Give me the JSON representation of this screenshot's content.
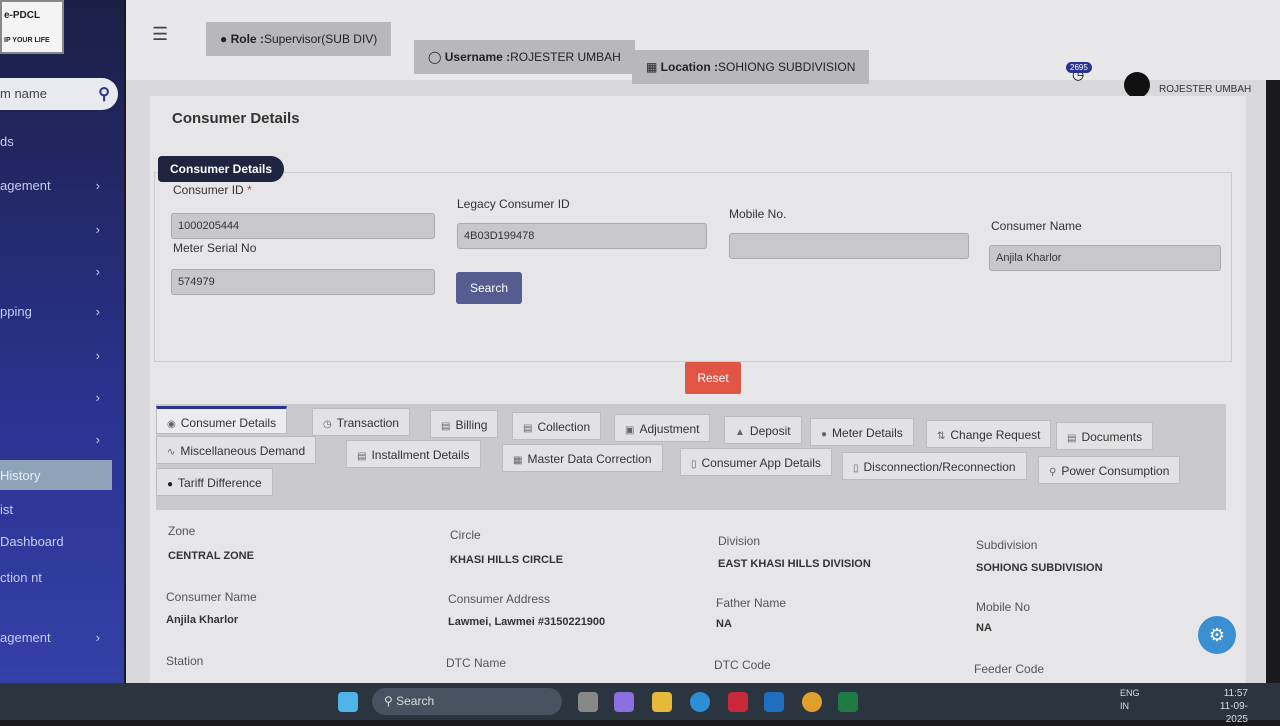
{
  "sidebar": {
    "logo_text": "e-PDCL",
    "logo_tagline": "IP YOUR LIFE",
    "search_placeholder": "m name",
    "items": [
      {
        "label": "ds"
      },
      {
        "label": "agement"
      },
      {
        "label": ""
      },
      {
        "label": ""
      },
      {
        "label": "pping"
      },
      {
        "label": ""
      },
      {
        "label": ""
      },
      {
        "label": "History"
      },
      {
        "label": "ist"
      },
      {
        "label": "Dashboard"
      },
      {
        "label": "ction nt"
      },
      {
        "label": "agement"
      }
    ]
  },
  "header": {
    "role_label": "Role :",
    "role_value": "Supervisor(SUB DIV)",
    "username_label": "Username :",
    "username_value": "ROJESTER UMBAH",
    "location_label": "Location :",
    "location_value": "SOHIONG SUBDIVISION",
    "notification_count": "2695",
    "user_name": "ROJESTER UMBAH"
  },
  "page": {
    "title": "Consumer Details",
    "form_badge": "Consumer Details"
  },
  "form": {
    "consumer_id_label": "Consumer ID",
    "consumer_id": "1000205444",
    "legacy_label": "Legacy Consumer ID",
    "legacy": "4B03D199478",
    "mobile_label": "Mobile No.",
    "mobile": "",
    "name_label": "Consumer Name",
    "name": "Anjila Kharlor",
    "meter_label": "Meter Serial No",
    "meter": "574979",
    "search": "Search",
    "reset": "Reset"
  },
  "tabs": [
    "Consumer Details",
    "Transaction",
    "Billing",
    "Collection",
    "Adjustment",
    "Deposit",
    "Meter Details",
    "Change Request",
    "Documents",
    "Miscellaneous Demand",
    "Installment Details",
    "Master Data Correction",
    "Consumer App Details",
    "Disconnection/Reconnection",
    "Power Consumption",
    "Tariff Difference"
  ],
  "details": [
    {
      "label": "Zone",
      "value": "CENTRAL ZONE"
    },
    {
      "label": "Circle",
      "value": "KHASI HILLS CIRCLE"
    },
    {
      "label": "Division",
      "value": "EAST KHASI HILLS DIVISION"
    },
    {
      "label": "Subdivision",
      "value": "SOHIONG SUBDIVISION"
    },
    {
      "label": "Consumer Name",
      "value": "Anjila Kharlor"
    },
    {
      "label": "Consumer Address",
      "value": "Lawmei, Lawmei #3150221900"
    },
    {
      "label": "Father Name",
      "value": "NA"
    },
    {
      "label": "Mobile No",
      "value": "NA"
    },
    {
      "label": "Station",
      "value": ""
    },
    {
      "label": "DTC Name",
      "value": ""
    },
    {
      "label": "DTC Code",
      "value": ""
    },
    {
      "label": "Feeder Code",
      "value": ""
    }
  ],
  "taskbar": {
    "search": "Search",
    "lang": "ENG",
    "region": "IN",
    "time": "11:57",
    "date": "11-09-2025"
  }
}
